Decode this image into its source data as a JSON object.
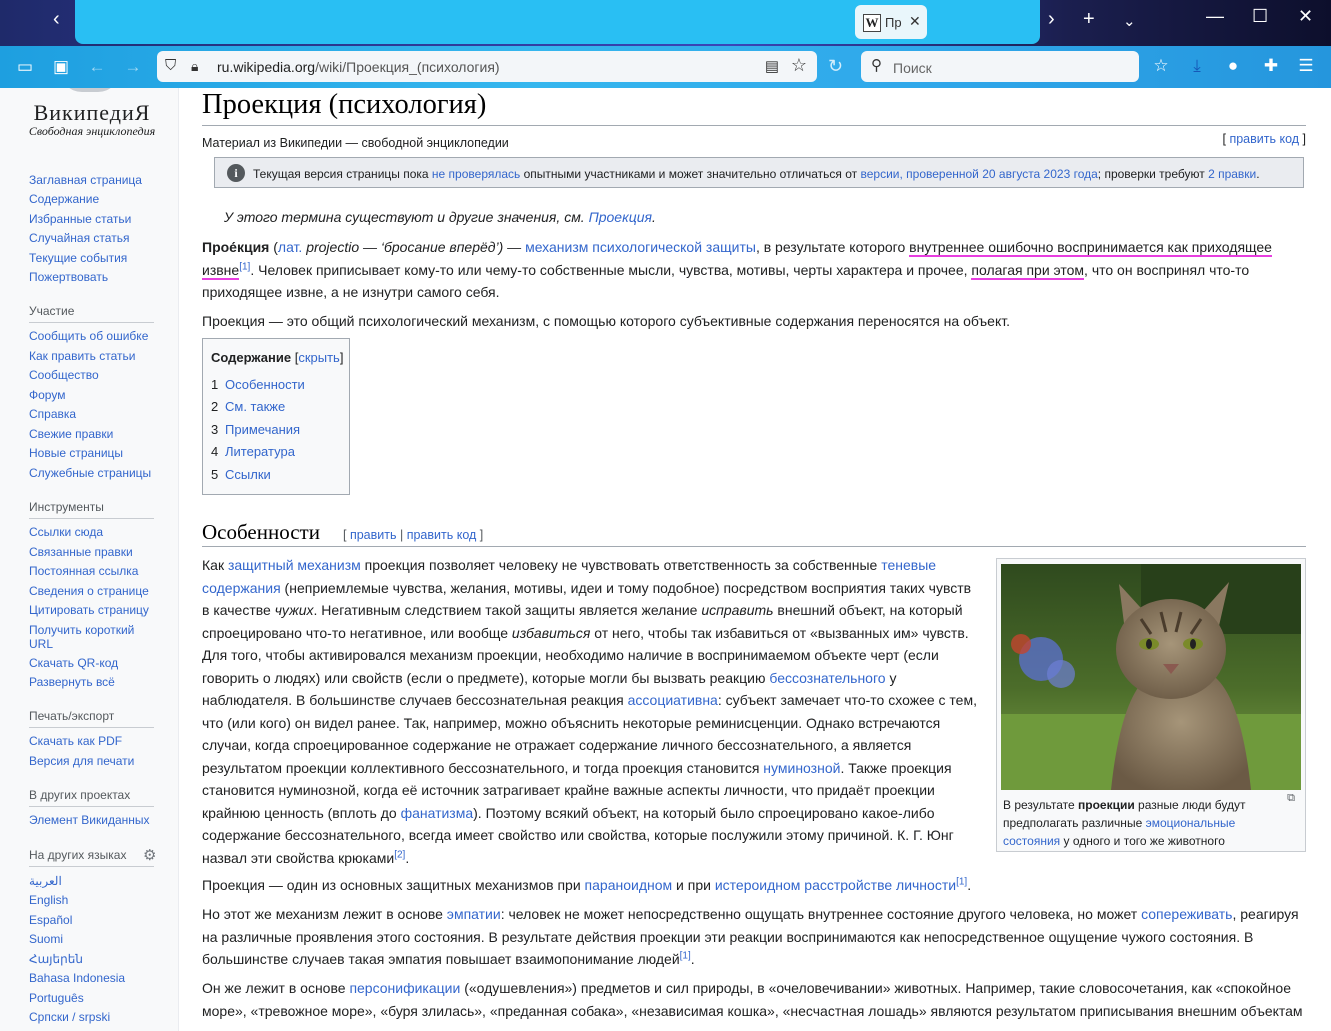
{
  "browser": {
    "tab_title": "Пр",
    "tab_favicon": "W",
    "url_domain": "ru.wikipedia.org",
    "url_path": "/wiki/Проекция_(психология)",
    "search_placeholder": "Поиск"
  },
  "sidebar": {
    "logo_title": "ВикипедиЯ",
    "logo_subtitle": "Свободная энциклопедия",
    "nav": [
      "Заглавная страница",
      "Содержание",
      "Избранные статьи",
      "Случайная статья",
      "Текущие события",
      "Пожертвовать"
    ],
    "participation_head": "Участие",
    "participation": [
      "Сообщить об ошибке",
      "Как править статьи",
      "Сообщество",
      "Форум",
      "Справка",
      "Свежие правки",
      "Новые страницы",
      "Служебные страницы"
    ],
    "tools_head": "Инструменты",
    "tools": [
      "Ссылки сюда",
      "Связанные правки",
      "Постоянная ссылка",
      "Сведения о странице",
      "Цитировать страницу",
      "Получить короткий URL",
      "Скачать QR-код",
      "Развернуть всё"
    ],
    "print_head": "Печать/экспорт",
    "print": [
      "Скачать как PDF",
      "Версия для печати"
    ],
    "projects_head": "В других проектах",
    "projects": [
      "Элемент Викиданных"
    ],
    "languages_head": "На других языках",
    "languages": [
      "العربية",
      "English",
      "Español",
      "Suomi",
      "Հայերեն",
      "Bahasa Indonesia",
      "Português",
      "Српски / srpski"
    ]
  },
  "article": {
    "title": "Проекция (психология)",
    "tagline": "Материал из Википедии — свободной энциклопедии",
    "edit_code": "править код",
    "notice_1": "Текущая версия страницы пока ",
    "notice_link1": "не проверялась",
    "notice_2": " опытными участниками и может значительно отличаться от ",
    "notice_link2": "версии, проверенной 20 августа 2023 года",
    "notice_3": "; проверки требуют ",
    "notice_link3": "2 правки",
    "notice_4": ".",
    "hatnote": "У этого термина существуют и другие значения, см. ",
    "hatnote_link": "Проекция",
    "p1_bold": "Прое́кция",
    "p1_a": " (",
    "p1_lat": "лат.",
    "p1_b": " projectio — ‘бросание вперёд’) — ",
    "p1_link": "механизм психологической защиты",
    "p1_c": ", в результате которого ",
    "p1_hl1": "внутреннее ошибочно воспринимается как приходящее извне",
    "p1_ref": "[1]",
    "p1_d": ". Человек приписывает кому-то или чему-то собственные мысли, чувства, мотивы, черты характера и прочее, ",
    "p1_hl2": "полагая при этом",
    "p1_e": ", что он воспринял что-то приходящее извне, а не изнутри самого себя.",
    "p2": "Проекция — это общий психологический механизм, с помощью которого субъективные содержания переносятся на объект.",
    "toc_title": "Содержание",
    "toc_hide": "скрыть",
    "toc": [
      {
        "n": "1",
        "t": "Особенности"
      },
      {
        "n": "2",
        "t": "См. также"
      },
      {
        "n": "3",
        "t": "Примечания"
      },
      {
        "n": "4",
        "t": "Литература"
      },
      {
        "n": "5",
        "t": "Ссылки"
      }
    ],
    "h2": "Особенности",
    "h2_edit": "править",
    "h2_edit_code": "править код",
    "s1": {
      "a": "Как ",
      "l1": "защитный механизм",
      "b": " проекция позволяет человеку не чувствовать ответственность за собственные ",
      "l2": "теневые содержания",
      "c": " (неприемлемые чувства, желания, мотивы, идеи и тому подобное) посредством восприятия таких чувств в качестве ",
      "i1": "чужих",
      "d": ". Негативным следствием такой защиты является желание ",
      "i2": "исправить",
      "e": " внешний объект, на который спроецировано что-то негативное, или вообще ",
      "i3": "избавиться",
      "f": " от него, чтобы так избавиться от «вызванных им» чувств. Для того, чтобы активировался механизм проекции, необходимо наличие в воспринимаемом объекте черт (если говорить о людях) или свойств (если о предмете), которые могли бы вызвать реакцию ",
      "l3": "бессознательного",
      "g": " у наблюдателя. В большинстве случаев бессознательная реакция ",
      "l4": "ассоциативна",
      "h": ": субъект замечает что-то схожее с тем, что (или кого) он видел ранее. Так, например, можно объяснить некоторые реминисценции. Однако встречаются случаи, когда спроецированное содержание не отражает содержание личного бессознательного, а является результатом проекции коллективного бессознательного, и тогда проекция становится ",
      "l5": "нуминозной",
      "j": ". Также проекция становится нуминозной, когда её источник затрагивает крайне важные аспекты личности, что придаёт проекции крайнюю ценность (вплоть до ",
      "l6": "фанатизма",
      "k": "). Поэтому всякий объект, на который было спроецировано какое-либо содержание бессознательного, всегда имеет свойство или свойства, которые послужили этому причиной. К. Г. Юнг назвал эти свойства крюками",
      "ref": "[2]",
      "end": "."
    },
    "s2": {
      "a": "Проекция — один из основных защитных механизмов при ",
      "l1": "параноидном",
      "b": " и при ",
      "l2": "истероидном расстройстве личности",
      "ref": "[1]",
      "end": "."
    },
    "s3": {
      "a": "Но этот же механизм лежит в основе ",
      "l1": "эмпатии",
      "b": ": человек не может непосредственно ощущать внутреннее состояние другого человека, но может ",
      "l2": "сопереживать",
      "c": ", реагируя на различные проявления этого состояния. В результате действия проекции эти реакции воспринимаются как непосредственное ощущение чужого состояния. В большинстве случаев такая эмпатия повышает взаимопонимание людей",
      "ref": "[1]",
      "end": "."
    },
    "s4": {
      "a": "Он же лежит в основе ",
      "l1": "персонификации",
      "b": " («одушевления») предметов и сил природы, в «очеловечивании» животных. Например, такие словосочетания, как «спокойное море», «тревожное море», «буря злилась», «преданная собака», «независимая кошка», «несчастная лошадь» являются результатом приписывания внешним объектам"
    },
    "thumb": {
      "cap_a": "В результате ",
      "cap_b": "проекции",
      "cap_c": " разные люди будут предполагать различные ",
      "cap_link": "эмоциональные состояния",
      "cap_d": " у одного и того же животного"
    }
  },
  "colors": {
    "link": "#3366cc",
    "highlight": "#e83ee0",
    "tabstrip": "#29bff3",
    "navbar": "#2fa7ea"
  }
}
